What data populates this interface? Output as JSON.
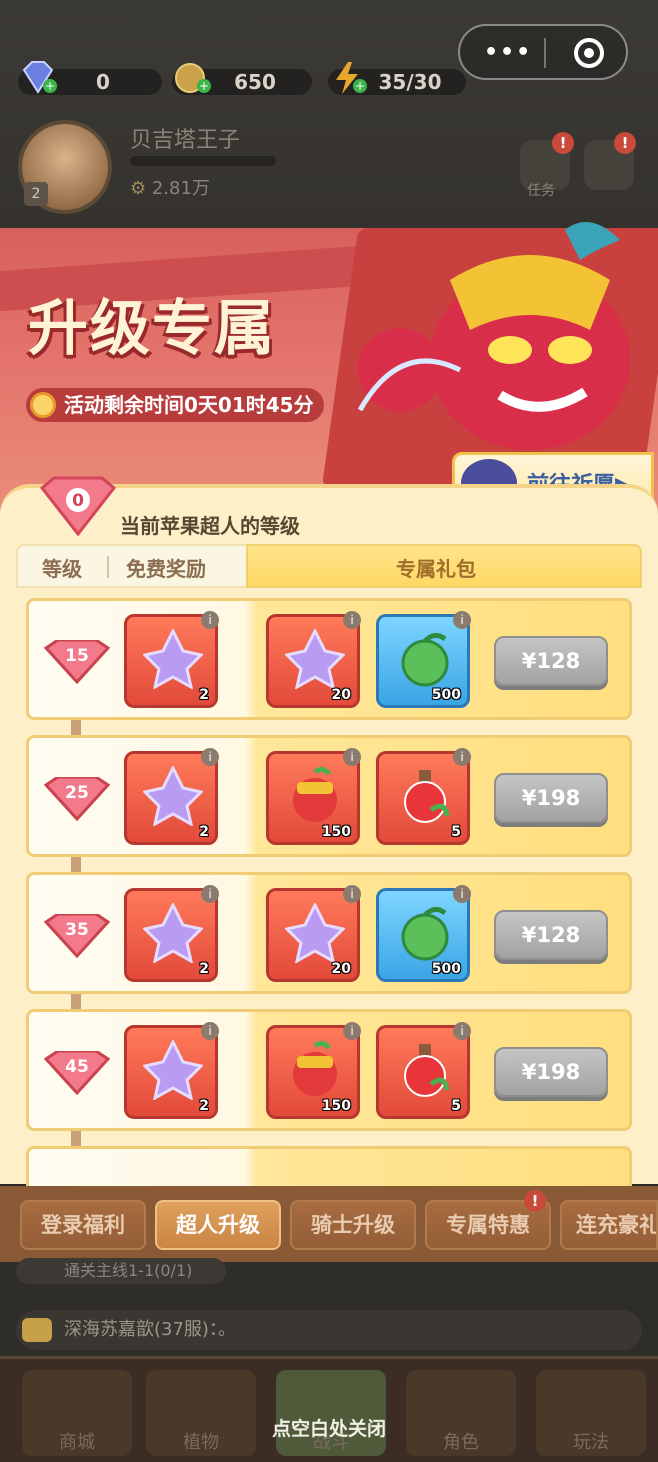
{
  "top_bar": {
    "diamonds": "0",
    "coins": "650",
    "energy": "35/30"
  },
  "player": {
    "name": "贝吉塔王子",
    "level": "2",
    "power": "2.81万",
    "task_label": "任务",
    "badge": "!"
  },
  "banner": {
    "title": "升级专属",
    "timer": "活动剩余时间0天01时45分",
    "pray_button": "前往祈愿▶"
  },
  "panel": {
    "current_level": "0",
    "current_level_label": "当前苹果超人的等级",
    "headers": {
      "level": "等级",
      "free": "免费奖励",
      "exclusive": "专属礼包"
    },
    "rows": [
      {
        "level": "15",
        "free_count": "2",
        "items": [
          {
            "type": "star",
            "count": "20"
          },
          {
            "type": "seed",
            "count": "500"
          }
        ],
        "price": "¥128"
      },
      {
        "level": "25",
        "free_count": "2",
        "items": [
          {
            "type": "apple-hero",
            "count": "150"
          },
          {
            "type": "potion",
            "count": "5"
          }
        ],
        "price": "¥198"
      },
      {
        "level": "35",
        "free_count": "2",
        "items": [
          {
            "type": "star",
            "count": "20"
          },
          {
            "type": "seed",
            "count": "500"
          }
        ],
        "price": "¥128"
      },
      {
        "level": "45",
        "free_count": "2",
        "items": [
          {
            "type": "apple-hero",
            "count": "150"
          },
          {
            "type": "potion",
            "count": "5"
          }
        ],
        "price": "¥198"
      }
    ]
  },
  "tabs": [
    {
      "label": "登录福利",
      "active": false
    },
    {
      "label": "超人升级",
      "active": true
    },
    {
      "label": "骑士升级",
      "active": false
    },
    {
      "label": "专属特惠",
      "active": false,
      "badge": "!"
    },
    {
      "label": "连充豪礼",
      "active": false
    }
  ],
  "chat": {
    "line1": "通关主线1-1(0/1)",
    "line2": "深海苏嘉歆(37服)：。"
  },
  "nav": [
    "商城",
    "植物",
    "战斗",
    "角色",
    "玩法"
  ],
  "close_hint": "点空白处关闭",
  "colors": {
    "panel_bg": "#fdf0c9",
    "banner_red": "#d8605a",
    "gold": "#ffd866",
    "price_gray": "#b3b3b3"
  }
}
